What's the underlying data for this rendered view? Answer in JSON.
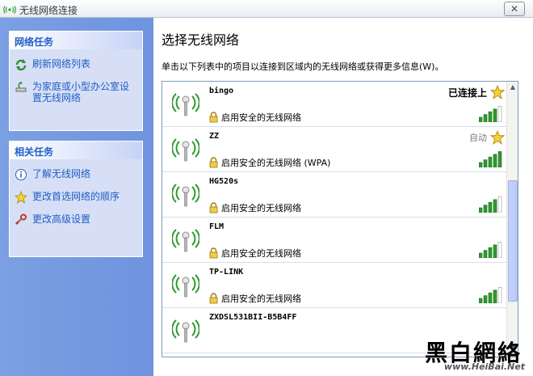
{
  "window": {
    "title": "无线网络连接",
    "close_symbol": "✕"
  },
  "left": {
    "network_tasks": {
      "title": "网络任务",
      "items": [
        {
          "label": "刷新网络列表",
          "icon": "refresh-icon"
        },
        {
          "label": "为家庭或小型办公室设置无线网络",
          "icon": "setup-network-icon"
        }
      ]
    },
    "related_tasks": {
      "title": "相关任务",
      "items": [
        {
          "label": "了解无线网络",
          "icon": "info-icon"
        },
        {
          "label": "更改首选网络的顺序",
          "icon": "star-icon"
        },
        {
          "label": "更改高级设置",
          "icon": "settings-icon"
        }
      ]
    }
  },
  "main": {
    "heading": "选择无线网络",
    "description": "单击以下列表中的项目以连接到区域内的无线网络或获得更多信息(W)。",
    "networks": [
      {
        "name": "bingo",
        "status": "已连接上",
        "security": "启用安全的无线网络",
        "signal": 4,
        "preferred": true
      },
      {
        "name": "ZZ",
        "status": "自动",
        "security": "启用安全的无线网络 (WPA)",
        "signal": 5,
        "preferred": true
      },
      {
        "name": "HG520s",
        "status": "",
        "security": "启用安全的无线网络",
        "signal": 4,
        "preferred": false
      },
      {
        "name": "FLM",
        "status": "",
        "security": "启用安全的无线网络",
        "signal": 4,
        "preferred": false
      },
      {
        "name": "TP-LINK",
        "status": "",
        "security": "启用安全的无线网络",
        "signal": 4,
        "preferred": false
      },
      {
        "name": "ZXDSL531BII-B5B4FF",
        "status": "",
        "security": "",
        "signal": 0,
        "preferred": false
      }
    ]
  },
  "watermark": {
    "logo": "黑白網絡",
    "url": "www.HeiBai.Net"
  },
  "colors": {
    "accent": "#215dc6",
    "signal": "#2e9a2e"
  }
}
